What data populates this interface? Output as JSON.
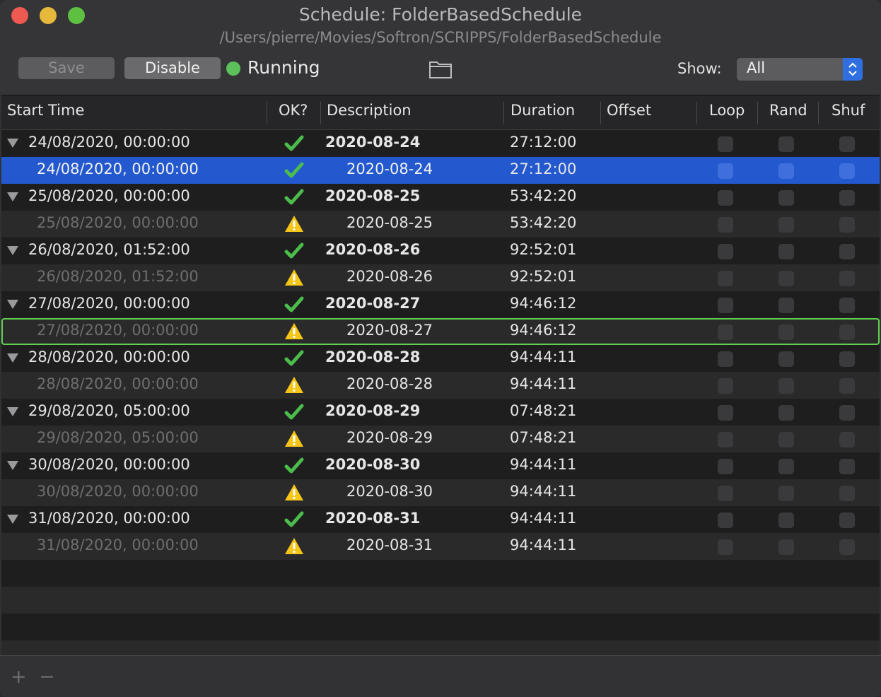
{
  "window": {
    "title": "Schedule: FolderBasedSchedule",
    "subtitle": "/Users/pierre/Movies/Softron/SCRIPPS/FolderBasedSchedule"
  },
  "toolbar": {
    "save_label": "Save",
    "disable_label": "Disable",
    "status": "Running",
    "status_color": "#5cc15a",
    "folder_icon": "folder-icon",
    "show_label": "Show:",
    "show_value": "All"
  },
  "columns": [
    "Start Time",
    "OK?",
    "Description",
    "Duration",
    "Offset",
    "Loop",
    "Rand",
    "Shuf"
  ],
  "rows": [
    {
      "start": "24/08/2020, 00:00:00",
      "ok": "check",
      "desc": "2020-08-24",
      "dur": "27:12:00",
      "parent": true
    },
    {
      "start": "24/08/2020, 00:00:00",
      "ok": "check",
      "desc": "2020-08-24",
      "dur": "27:12:00",
      "parent": false,
      "selected": true
    },
    {
      "start": "25/08/2020, 00:00:00",
      "ok": "check",
      "desc": "2020-08-25",
      "dur": "53:42:20",
      "parent": true
    },
    {
      "start": "25/08/2020, 00:00:00",
      "ok": "warning",
      "desc": "2020-08-25",
      "dur": "53:42:20",
      "parent": false
    },
    {
      "start": "26/08/2020, 01:52:00",
      "ok": "check",
      "desc": "2020-08-26",
      "dur": "92:52:01",
      "parent": true
    },
    {
      "start": "26/08/2020, 01:52:00",
      "ok": "warning",
      "desc": "2020-08-26",
      "dur": "92:52:01",
      "parent": false
    },
    {
      "start": "27/08/2020, 00:00:00",
      "ok": "check",
      "desc": "2020-08-27",
      "dur": "94:46:12",
      "parent": true
    },
    {
      "start": "27/08/2020, 00:00:00",
      "ok": "warning",
      "desc": "2020-08-27",
      "dur": "94:46:12",
      "parent": false,
      "focused": true
    },
    {
      "start": "28/08/2020, 00:00:00",
      "ok": "check",
      "desc": "2020-08-28",
      "dur": "94:44:11",
      "parent": true
    },
    {
      "start": "28/08/2020, 00:00:00",
      "ok": "warning",
      "desc": "2020-08-28",
      "dur": "94:44:11",
      "parent": false
    },
    {
      "start": "29/08/2020, 05:00:00",
      "ok": "check",
      "desc": "2020-08-29",
      "dur": "07:48:21",
      "parent": true
    },
    {
      "start": "29/08/2020, 05:00:00",
      "ok": "warning",
      "desc": "2020-08-29",
      "dur": "07:48:21",
      "parent": false
    },
    {
      "start": "30/08/2020, 00:00:00",
      "ok": "check",
      "desc": "2020-08-30",
      "dur": "94:44:11",
      "parent": true
    },
    {
      "start": "30/08/2020, 00:00:00",
      "ok": "warning",
      "desc": "2020-08-30",
      "dur": "94:44:11",
      "parent": false
    },
    {
      "start": "31/08/2020, 00:00:00",
      "ok": "check",
      "desc": "2020-08-31",
      "dur": "94:44:11",
      "parent": true
    },
    {
      "start": "31/08/2020, 00:00:00",
      "ok": "warning",
      "desc": "2020-08-31",
      "dur": "94:44:11",
      "parent": false
    }
  ],
  "icons": {
    "ok": "checkmark-icon",
    "warn": "warning-icon"
  },
  "colors": {
    "check": "#4cbd4c",
    "warning": "#f5c518",
    "selection": "#2358cf",
    "focus": "#5fd14e"
  },
  "footer": {
    "add_label": "+",
    "remove_label": "−"
  }
}
